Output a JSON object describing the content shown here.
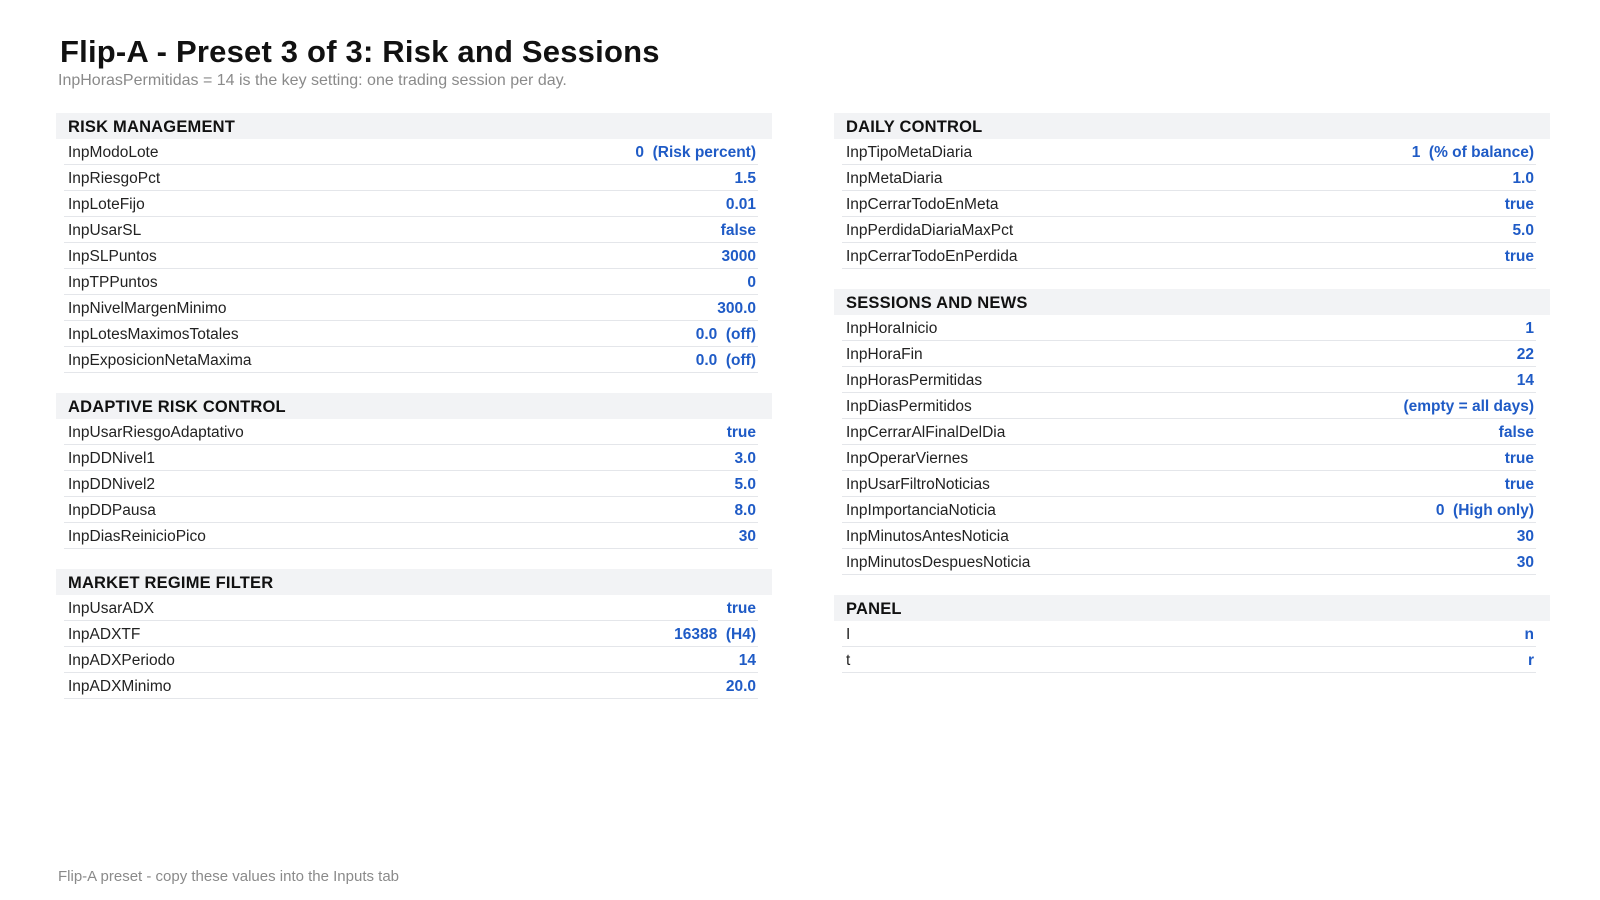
{
  "header": {
    "title": "Flip-A - Preset 3 of 3: Risk and Sessions",
    "subtitle": "InpHorasPermitidas = 14 is the key setting: one trading session per day."
  },
  "left": [
    {
      "title": "RISK MANAGEMENT",
      "rows": [
        {
          "name": "InpModoLote",
          "value": "0  (Risk percent)"
        },
        {
          "name": "InpRiesgoPct",
          "value": "1.5"
        },
        {
          "name": "InpLoteFijo",
          "value": "0.01"
        },
        {
          "name": "InpUsarSL",
          "value": "false"
        },
        {
          "name": "InpSLPuntos",
          "value": "3000"
        },
        {
          "name": "InpTPPuntos",
          "value": "0"
        },
        {
          "name": "InpNivelMargenMinimo",
          "value": "300.0"
        },
        {
          "name": "InpLotesMaximosTotales",
          "value": "0.0  (off)"
        },
        {
          "name": "InpExposicionNetaMaxima",
          "value": "0.0  (off)"
        }
      ]
    },
    {
      "title": "ADAPTIVE RISK CONTROL",
      "rows": [
        {
          "name": "InpUsarRiesgoAdaptativo",
          "value": "true"
        },
        {
          "name": "InpDDNivel1",
          "value": "3.0"
        },
        {
          "name": "InpDDNivel2",
          "value": "5.0"
        },
        {
          "name": "InpDDPausa",
          "value": "8.0"
        },
        {
          "name": "InpDiasReinicioPico",
          "value": "30"
        }
      ]
    },
    {
      "title": "MARKET REGIME FILTER",
      "rows": [
        {
          "name": "InpUsarADX",
          "value": "true"
        },
        {
          "name": "InpADXTF",
          "value": "16388  (H4)"
        },
        {
          "name": "InpADXPeriodo",
          "value": "14"
        },
        {
          "name": "InpADXMinimo",
          "value": "20.0"
        }
      ]
    }
  ],
  "right": [
    {
      "title": "DAILY CONTROL",
      "rows": [
        {
          "name": "InpTipoMetaDiaria",
          "value": "1  (% of balance)"
        },
        {
          "name": "InpMetaDiaria",
          "value": "1.0"
        },
        {
          "name": "InpCerrarTodoEnMeta",
          "value": "true"
        },
        {
          "name": "InpPerdidaDiariaMaxPct",
          "value": "5.0"
        },
        {
          "name": "InpCerrarTodoEnPerdida",
          "value": "true"
        }
      ]
    },
    {
      "title": "SESSIONS AND NEWS",
      "rows": [
        {
          "name": "InpHoraInicio",
          "value": "1"
        },
        {
          "name": "InpHoraFin",
          "value": "22"
        },
        {
          "name": "InpHorasPermitidas",
          "value": "14"
        },
        {
          "name": "InpDiasPermitidos",
          "value": "(empty = all days)"
        },
        {
          "name": "InpCerrarAlFinalDelDia",
          "value": "false"
        },
        {
          "name": "InpOperarViernes",
          "value": "true"
        },
        {
          "name": "InpUsarFiltroNoticias",
          "value": "true"
        },
        {
          "name": "InpImportanciaNoticia",
          "value": "0  (High only)"
        },
        {
          "name": "InpMinutosAntesNoticia",
          "value": "30"
        },
        {
          "name": "InpMinutosDespuesNoticia",
          "value": "30"
        }
      ]
    },
    {
      "title": "PANEL",
      "rows": [
        {
          "name": "I",
          "value": "n"
        },
        {
          "name": "t",
          "value": "r"
        }
      ]
    }
  ],
  "footer": "Flip-A preset - copy these values into the Inputs tab"
}
